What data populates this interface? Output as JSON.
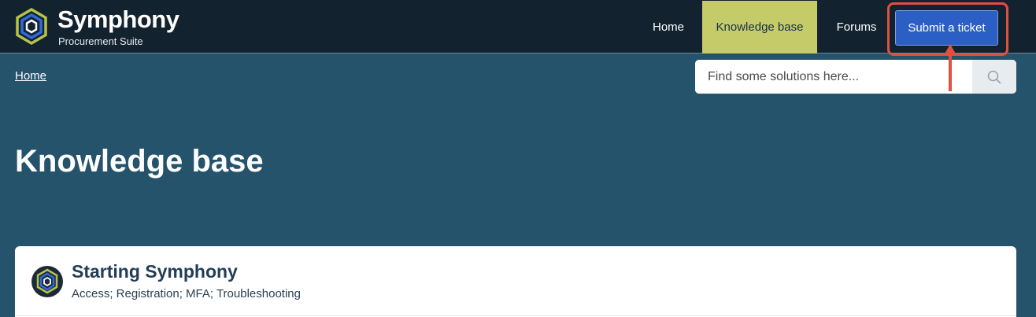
{
  "brand": {
    "name": "Symphony",
    "subtitle": "Procurement Suite",
    "logo_icon": "hexagon-logo-icon"
  },
  "nav": {
    "home": "Home",
    "knowledge_base": "Knowledge base",
    "forums": "Forums",
    "submit_ticket": "Submit a ticket",
    "active_color": "#c6cb6a",
    "submit_color": "#2c5fc4"
  },
  "breadcrumb": {
    "home": "Home"
  },
  "search": {
    "placeholder": "Find some solutions here...",
    "icon": "search-icon"
  },
  "page": {
    "title": "Knowledge base"
  },
  "categories": [
    {
      "title": "Starting Symphony",
      "description": "Access; Registration; MFA; Troubleshooting",
      "icon": "hexagon-logo-icon"
    }
  ],
  "annotation": {
    "highlight_color": "#e0503f"
  }
}
